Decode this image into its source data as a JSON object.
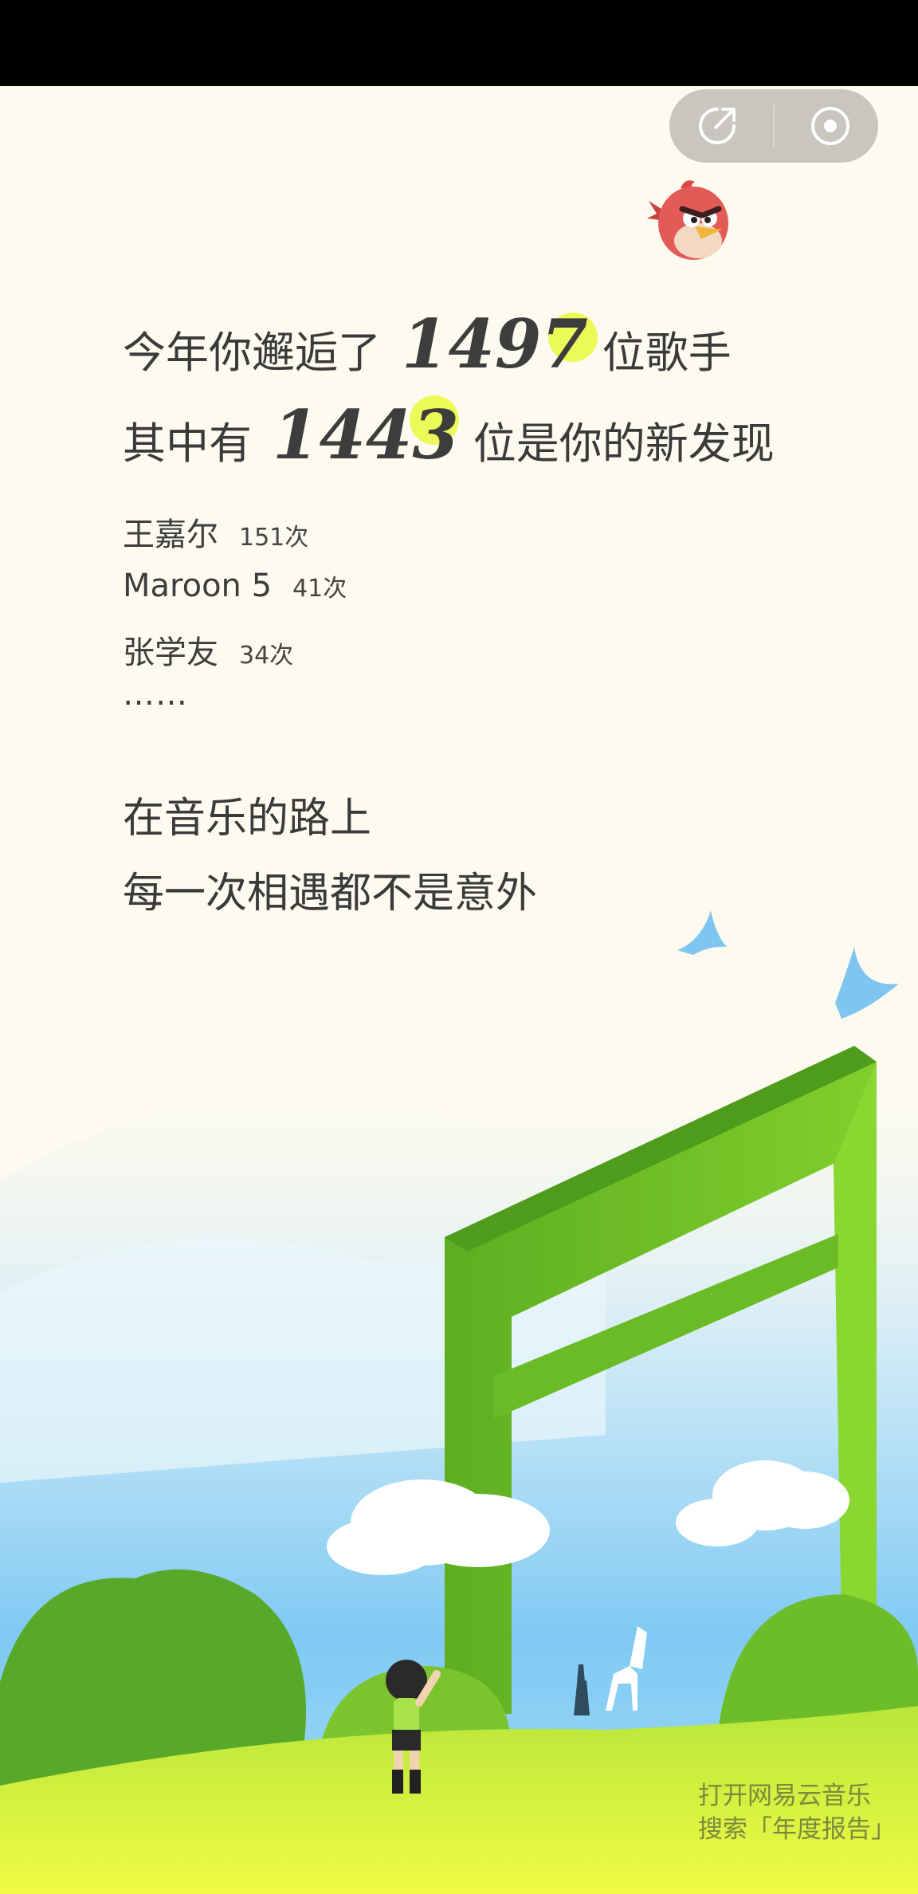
{
  "summary": {
    "singers_prefix": "今年你邂逅了",
    "singers_count": "1497",
    "singers_suffix": "位歌手",
    "new_prefix": "其中有",
    "new_count": "1443",
    "new_suffix": "位是你的新发现"
  },
  "top_artists": [
    {
      "name": "王嘉尔",
      "count": "151次"
    },
    {
      "name": "Maroon 5",
      "count": "41次"
    },
    {
      "name": "张学友",
      "count": "34次"
    }
  ],
  "more_indicator": "……",
  "slogan": {
    "line1": "在音乐的路上",
    "line2": "每一次相遇都不是意外"
  },
  "footer": {
    "line1": "打开网易云音乐",
    "line2": "搜索「年度报告」"
  },
  "capsule": {
    "share_icon": "share-arrow-icon",
    "close_icon": "target-circle-icon"
  },
  "colors": {
    "background": "#fdfaef",
    "highlight": "#e9f93e",
    "grass": "#7ccc2a",
    "sky": "#8ed0f5"
  }
}
